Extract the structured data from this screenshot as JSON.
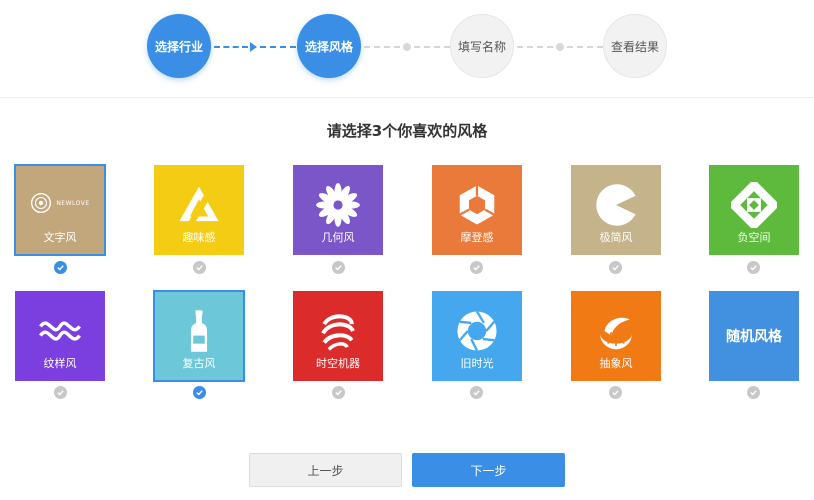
{
  "stepper": {
    "steps": [
      {
        "label": "选择行业",
        "state": "done"
      },
      {
        "label": "选择风格",
        "state": "current"
      },
      {
        "label": "填写名称",
        "state": "pending"
      },
      {
        "label": "查看结果",
        "state": "pending"
      }
    ],
    "accent_color": "#3a8ee6"
  },
  "prompt": "请选择3个你喜欢的风格",
  "styles": [
    {
      "label": "文字风",
      "color": "#c2a67c",
      "icon": "logo-seal-icon",
      "logo_text": "NEWLOVE",
      "selected": true
    },
    {
      "label": "趣味感",
      "color": "#f5cc14",
      "icon": "triangle-icon",
      "selected": false
    },
    {
      "label": "几何风",
      "color": "#7b56c9",
      "icon": "flower-icon",
      "selected": false
    },
    {
      "label": "摩登感",
      "color": "#ea7a3a",
      "icon": "hexagon-icon",
      "selected": false
    },
    {
      "label": "极简风",
      "color": "#c5b38b",
      "icon": "pacman-icon",
      "selected": false
    },
    {
      "label": "负空间",
      "color": "#5dba3c",
      "icon": "cross-arrows-icon",
      "selected": false
    },
    {
      "label": "纹样风",
      "color": "#7b3fe0",
      "icon": "wave-pattern-icon",
      "selected": false
    },
    {
      "label": "复古风",
      "color": "#6cc8d8",
      "icon": "bottle-icon",
      "selected": true
    },
    {
      "label": "时空机器",
      "color": "#dc2b2b",
      "icon": "swirl-icon",
      "selected": false
    },
    {
      "label": "旧时光",
      "color": "#45a8ef",
      "icon": "aperture-icon",
      "selected": false
    },
    {
      "label": "抽象风",
      "color": "#f17a14",
      "icon": "shell-icon",
      "selected": false
    },
    {
      "label": "随机风格",
      "color": "#4191e0",
      "icon": "none",
      "selected": false
    }
  ],
  "buttons": {
    "prev": "上一步",
    "next": "下一步"
  }
}
